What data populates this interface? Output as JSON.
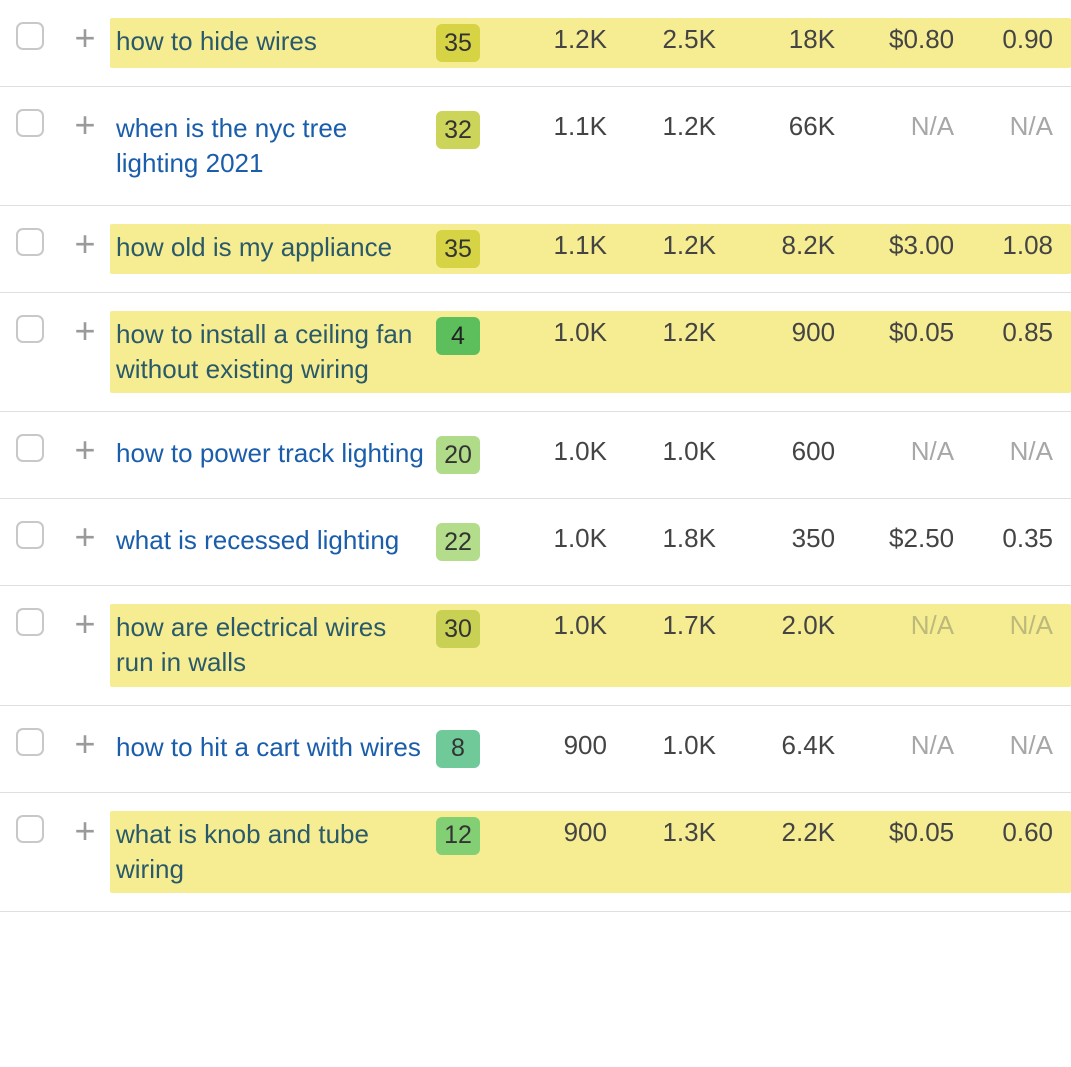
{
  "rows": [
    {
      "keyword": "how to hide wires",
      "highlighted": true,
      "kdClass": "badge-35",
      "kd": "35",
      "volume": "1.2K",
      "col2": "2.5K",
      "col3": "18K",
      "cpc": "$0.80",
      "last": "0.90",
      "cpcNA": false,
      "lastNA": false
    },
    {
      "keyword": "when is the nyc tree lighting 2021",
      "highlighted": false,
      "kdClass": "badge-32",
      "kd": "32",
      "volume": "1.1K",
      "col2": "1.2K",
      "col3": "66K",
      "cpc": "N/A",
      "last": "N/A",
      "cpcNA": true,
      "lastNA": true
    },
    {
      "keyword": "how old is my appliance",
      "highlighted": true,
      "kdClass": "badge-35",
      "kd": "35",
      "volume": "1.1K",
      "col2": "1.2K",
      "col3": "8.2K",
      "cpc": "$3.00",
      "last": "1.08",
      "cpcNA": false,
      "lastNA": false
    },
    {
      "keyword": "how to install a ceiling fan without existing wiring",
      "highlighted": true,
      "kdClass": "badge-4",
      "kd": "4",
      "volume": "1.0K",
      "col2": "1.2K",
      "col3": "900",
      "cpc": "$0.05",
      "last": "0.85",
      "cpcNA": false,
      "lastNA": false
    },
    {
      "keyword": "how to power track lighting",
      "highlighted": false,
      "kdClass": "badge-20",
      "kd": "20",
      "volume": "1.0K",
      "col2": "1.0K",
      "col3": "600",
      "cpc": "N/A",
      "last": "N/A",
      "cpcNA": true,
      "lastNA": true
    },
    {
      "keyword": "what is recessed lighting",
      "highlighted": false,
      "kdClass": "badge-22",
      "kd": "22",
      "volume": "1.0K",
      "col2": "1.8K",
      "col3": "350",
      "cpc": "$2.50",
      "last": "0.35",
      "cpcNA": false,
      "lastNA": false
    },
    {
      "keyword": "how are electrical wires run in walls",
      "highlighted": true,
      "kdClass": "badge-30",
      "kd": "30",
      "volume": "1.0K",
      "col2": "1.7K",
      "col3": "2.0K",
      "cpc": "N/A",
      "last": "N/A",
      "cpcNA": true,
      "lastNA": true
    },
    {
      "keyword": "how to hit a cart with wires",
      "highlighted": false,
      "kdClass": "badge-8",
      "kd": "8",
      "volume": "900",
      "col2": "1.0K",
      "col3": "6.4K",
      "cpc": "N/A",
      "last": "N/A",
      "cpcNA": true,
      "lastNA": true
    },
    {
      "keyword": "what is knob and tube wiring",
      "highlighted": true,
      "kdClass": "badge-12",
      "kd": "12",
      "volume": "900",
      "col2": "1.3K",
      "col3": "2.2K",
      "cpc": "$0.05",
      "last": "0.60",
      "cpcNA": false,
      "lastNA": false
    }
  ]
}
